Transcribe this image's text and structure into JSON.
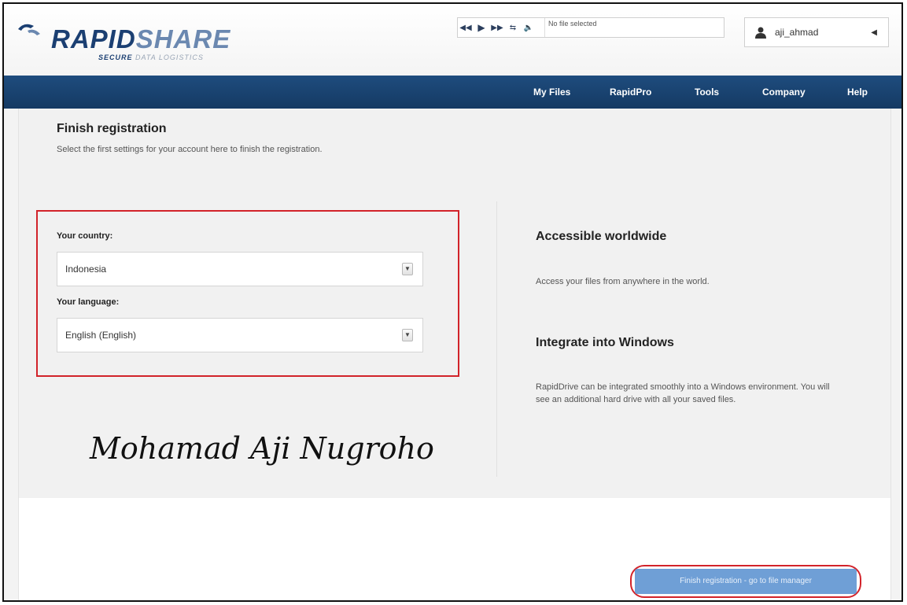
{
  "brand": {
    "name_bold": "RAPID",
    "name_light": "SHARE",
    "tagline_bold": "SECURE",
    "tagline_light": "DATA LOGISTICS"
  },
  "player": {
    "file_status": "No file selected",
    "icons": [
      "prev-icon",
      "play-icon",
      "next-icon",
      "share-icon",
      "volume-icon"
    ]
  },
  "user": {
    "name": "aji_ahmad"
  },
  "nav": {
    "items": [
      "My Files",
      "RapidPro",
      "Tools",
      "Company",
      "Help"
    ]
  },
  "page": {
    "title": "Finish registration",
    "subtitle": "Select the first settings for your account here to finish the registration."
  },
  "form": {
    "country_label": "Your country:",
    "country_value": "Indonesia",
    "language_label": "Your language:",
    "language_value": "English (English)"
  },
  "info": {
    "h1": "Accessible worldwide",
    "p1": "Access your files from anywhere in the world.",
    "h2": "Integrate into Windows",
    "p2": "RapidDrive can be integrated smoothly into a Windows environment. You will see an additional hard drive with all your saved files."
  },
  "watermark": "Mohamad Aji Nugroho",
  "footer": {
    "finish_button": "Finish registration - go to file manager"
  },
  "colors": {
    "nav_bg": "#1b4572",
    "highlight": "#d2232a",
    "button": "#6f9fd6"
  }
}
